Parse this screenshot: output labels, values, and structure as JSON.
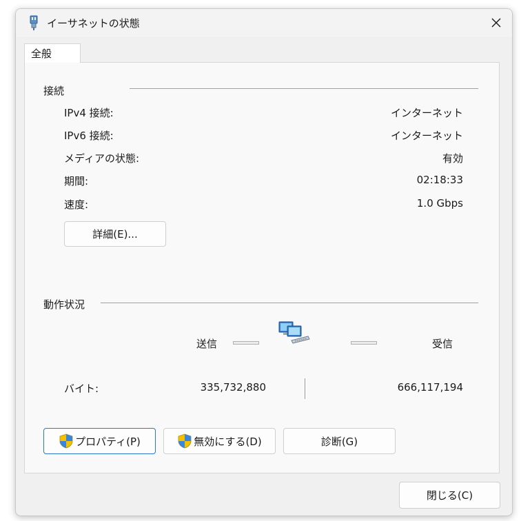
{
  "window": {
    "title": "イーサネットの状態",
    "close_label": "閉じる(C)"
  },
  "tabs": [
    {
      "label": "全般",
      "selected": true
    }
  ],
  "connection": {
    "group_label": "接続",
    "rows": [
      {
        "label": "IPv4 接続:",
        "value": "インターネット"
      },
      {
        "label": "IPv6 接続:",
        "value": "インターネット"
      },
      {
        "label": "メディアの状態:",
        "value": "有効"
      },
      {
        "label": "期間:",
        "value": "02:18:33"
      },
      {
        "label": "速度:",
        "value": "1.0 Gbps"
      }
    ],
    "details_button": "詳細(E)..."
  },
  "activity": {
    "group_label": "動作状況",
    "sent_label": "送信",
    "received_label": "受信",
    "bytes_label": "バイト:",
    "bytes_sent": "335,732,880",
    "bytes_received": "666,117,194"
  },
  "actions": {
    "properties": "プロパティ(P)",
    "disable": "無効にする(D)",
    "diagnose": "診断(G)"
  },
  "colors": {
    "accent": "#2a74c9",
    "window_bg": "#f0f0f0",
    "panel_bg": "#f9f9f9"
  },
  "icons": {
    "title": "ethernet-plug-icon",
    "close": "close-icon",
    "network": "network-computers-icon",
    "shield": "uac-shield-icon"
  }
}
